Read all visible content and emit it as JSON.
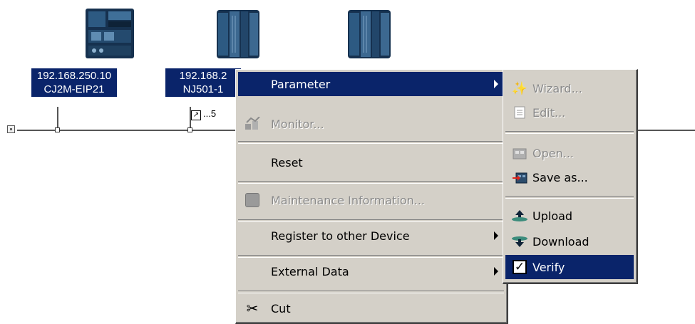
{
  "devices": [
    {
      "ip": "192.168.250.10",
      "name": "CJ2M-EIP21"
    },
    {
      "ip": "192.168.2",
      "name": "NJ501-1"
    },
    {
      "ip": "",
      "name": ""
    }
  ],
  "badge_text": "...5",
  "context_menu": {
    "items": [
      {
        "label": "Parameter",
        "state": "highlighted",
        "submenu": true,
        "icon": ""
      },
      {
        "label": "Monitor...",
        "state": "disabled",
        "submenu": false,
        "icon": "monitor-icon"
      },
      {
        "label": "Reset",
        "state": "normal",
        "submenu": false,
        "icon": ""
      },
      {
        "label": "Maintenance Information...",
        "state": "disabled",
        "submenu": false,
        "icon": "maintenance-icon"
      },
      {
        "label": "Register to other Device",
        "state": "normal",
        "submenu": true,
        "icon": ""
      },
      {
        "label": "External Data",
        "state": "normal",
        "submenu": true,
        "icon": ""
      },
      {
        "label": "Cut",
        "state": "normal",
        "submenu": false,
        "icon": "scissors-icon"
      }
    ]
  },
  "parameter_submenu": {
    "items": [
      {
        "label": "Wizard...",
        "state": "disabled",
        "icon": "wizard-icon"
      },
      {
        "label": "Edit...",
        "state": "disabled",
        "icon": "edit-icon"
      },
      {
        "label": "Open...",
        "state": "disabled",
        "icon": "open-icon"
      },
      {
        "label": "Save as...",
        "state": "normal",
        "icon": "save-icon"
      },
      {
        "label": "Upload",
        "state": "normal",
        "icon": "upload-icon"
      },
      {
        "label": "Download",
        "state": "normal",
        "icon": "download-icon"
      },
      {
        "label": "Verify",
        "state": "highlighted",
        "icon": "checkbox-icon"
      }
    ]
  },
  "colors": {
    "highlight": "#0a246a",
    "menu_bg": "#d4d0c8",
    "device_blue": "#1d3a5c"
  }
}
